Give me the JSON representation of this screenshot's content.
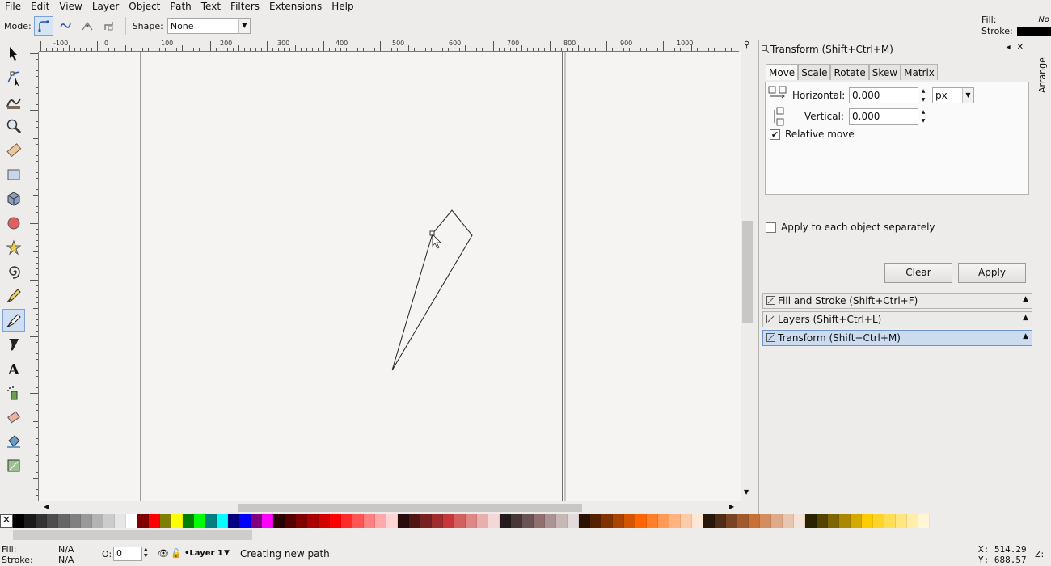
{
  "menu": [
    "File",
    "Edit",
    "View",
    "Layer",
    "Object",
    "Path",
    "Text",
    "Filters",
    "Extensions",
    "Help"
  ],
  "style_indicator": {
    "fill_label": "Fill:",
    "fill_value": "No",
    "stroke_label": "Stroke:",
    "stroke_color": "#000000"
  },
  "toolbar": {
    "mode_label": "Mode:",
    "modes": [
      "regular-bezier-icon",
      "spiro-path-icon",
      "bspline-path-icon",
      "paraxial-line-icon"
    ],
    "shape_label": "Shape:",
    "shape_value": "None"
  },
  "tools": [
    "selector-arrow-icon",
    "node-editor-icon",
    "tweak-icon",
    "zoom-icon",
    "measure-icon",
    "rectangle-icon",
    "3d-box-icon",
    "ellipse-icon",
    "star-icon",
    "spiral-icon",
    "pencil-icon",
    "pen-bezier-icon",
    "calligraphy-icon",
    "text-icon",
    "spray-icon",
    "eraser-icon",
    "paint-bucket-icon",
    "gradient-icon"
  ],
  "ruler": {
    "h_labels": [
      "-100",
      "0",
      "100",
      "200",
      "300",
      "400",
      "500",
      "600",
      "700",
      "800",
      "900",
      "1000"
    ]
  },
  "dialog": {
    "title": "Transform (Shift+Ctrl+M)",
    "tabs": [
      "Move",
      "Scale",
      "Rotate",
      "Skew",
      "Matrix"
    ],
    "active_tab": "Move",
    "horizontal_label": "Horizontal:",
    "horizontal_value": "0.000",
    "vertical_label": "Vertical:",
    "vertical_value": "0.000",
    "unit": "px",
    "relative_move_label": "Relative move",
    "relative_move_checked": true,
    "apply_each_label": "Apply to each object separately",
    "apply_each_checked": false,
    "clear_label": "Clear",
    "apply_label": "Apply"
  },
  "docked": [
    {
      "label": "Fill and Stroke (Shift+Ctrl+F)",
      "active": false
    },
    {
      "label": "Layers (Shift+Ctrl+L)",
      "active": false
    },
    {
      "label": "Transform (Shift+Ctrl+M)",
      "active": true
    }
  ],
  "arrange_label": "Arrange",
  "palette": [
    "#000000",
    "#1a1a1a",
    "#333333",
    "#4d4d4d",
    "#666666",
    "#808080",
    "#999999",
    "#b3b3b3",
    "#cccccc",
    "#e6e6e6",
    "#ffffff",
    "#800000",
    "#ff0000",
    "#808000",
    "#ffff00",
    "#008000",
    "#00ff00",
    "#008080",
    "#00ffff",
    "#000080",
    "#0000ff",
    "#800080",
    "#ff00ff",
    "#2b0000",
    "#550000",
    "#800000",
    "#aa0000",
    "#d40000",
    "#ff0000",
    "#ff2a2a",
    "#ff5555",
    "#ff8080",
    "#ffaaaa",
    "#ffd5d5",
    "#280b0b",
    "#501616",
    "#782121",
    "#a02c2c",
    "#c83737",
    "#d35f5f",
    "#de8787",
    "#e9afaf",
    "#f4d7d7",
    "#241c1c",
    "#483737",
    "#6c5353",
    "#916f6f",
    "#ac9393",
    "#c8b7b7",
    "#e3dbdb",
    "#2b1100",
    "#552200",
    "#803300",
    "#aa4400",
    "#d45500",
    "#ff6600",
    "#ff7f2a",
    "#ff9955",
    "#ffb380",
    "#ffccaa",
    "#ffe6d5",
    "#28170b",
    "#502d16",
    "#784421",
    "#a05a2c",
    "#c87137",
    "#d38d5f",
    "#deaa87",
    "#e9c6af",
    "#f4e3d7",
    "#2b2200",
    "#554400",
    "#806600",
    "#aa8800",
    "#d4aa00",
    "#ffcc00",
    "#ffd42a",
    "#ffdd55",
    "#ffe680",
    "#ffeeaa",
    "#fff6d5"
  ],
  "status": {
    "fill_label": "Fill:",
    "fill_value": "N/A",
    "stroke_label": "Stroke:",
    "stroke_value": "N/A",
    "opacity_label": "O:",
    "opacity_value": "0",
    "layer": "•Layer 1",
    "message": "Creating new path",
    "x": "X:  514.29",
    "y": "Y:  688.57",
    "z_label": "Z:"
  }
}
